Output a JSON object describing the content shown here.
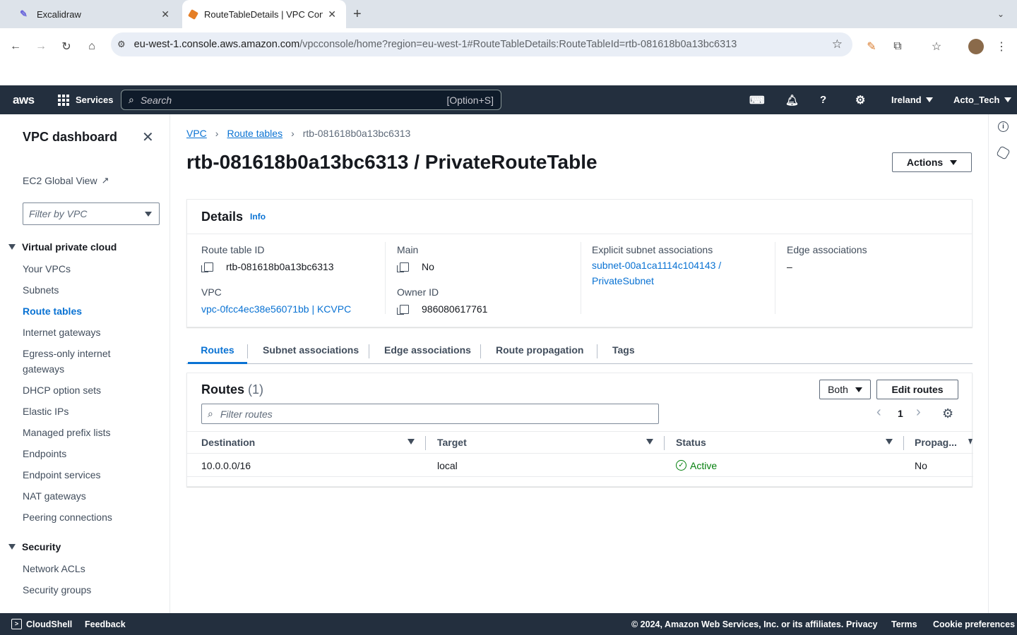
{
  "browser": {
    "tabs": [
      {
        "title": "Excalidraw"
      },
      {
        "title": "RouteTableDetails | VPC Cons"
      }
    ],
    "url_host": "eu-west-1.console.aws.amazon.com",
    "url_path": "/vpcconsole/home?region=eu-west-1#RouteTableDetails:RouteTableId=rtb-081618b0a13bc6313"
  },
  "aws_nav": {
    "logo": "aws",
    "services": "Services",
    "search_placeholder": "Search",
    "search_shortcut": "[Option+S]",
    "region": "Ireland",
    "account": "Acto_Tech"
  },
  "sidebar": {
    "title": "VPC dashboard",
    "ec2_global_view": "EC2 Global View",
    "filter_placeholder": "Filter by VPC",
    "section_vpc": "Virtual private cloud",
    "vpc_items": [
      "Your VPCs",
      "Subnets",
      "Route tables",
      "Internet gateways",
      "Egress-only internet gateways",
      "DHCP option sets",
      "Elastic IPs",
      "Managed prefix lists",
      "Endpoints",
      "Endpoint services",
      "NAT gateways",
      "Peering connections"
    ],
    "active_item": "Route tables",
    "section_security": "Security",
    "security_items": [
      "Network ACLs",
      "Security groups"
    ]
  },
  "breadcrumb": {
    "vpc": "VPC",
    "route_tables": "Route tables",
    "current": "rtb-081618b0a13bc6313"
  },
  "page_title": "rtb-081618b0a13bc6313 / PrivateRouteTable",
  "actions_label": "Actions",
  "details": {
    "title": "Details",
    "info": "Info",
    "route_table_id_label": "Route table ID",
    "route_table_id": "rtb-081618b0a13bc6313",
    "vpc_label": "VPC",
    "vpc": "vpc-0fcc4ec38e56071bb | KCVPC",
    "main_label": "Main",
    "main": "No",
    "owner_label": "Owner ID",
    "owner": "986080617761",
    "explicit_label": "Explicit subnet associations",
    "explicit_line1": "subnet-00a1ca1114c104143 /",
    "explicit_line2": "PrivateSubnet",
    "edge_label": "Edge associations",
    "edge": "–"
  },
  "tabs": [
    "Routes",
    "Subnet associations",
    "Edge associations",
    "Route propagation",
    "Tags"
  ],
  "routes": {
    "title": "Routes",
    "count": "(1)",
    "both_label": "Both",
    "edit_label": "Edit routes",
    "filter_placeholder": "Filter routes",
    "page": "1",
    "columns": [
      "Destination",
      "Target",
      "Status",
      "Propag..."
    ],
    "rows": [
      {
        "destination": "10.0.0.0/16",
        "target": "local",
        "status": "Active",
        "propagated": "No"
      }
    ],
    "status_color": "#037f0c"
  },
  "footer": {
    "cloudshell": "CloudShell",
    "feedback": "Feedback",
    "copyright": "© 2024, Amazon Web Services, Inc. or its affiliates.",
    "privacy": "Privacy",
    "terms": "Terms",
    "cookies": "Cookie preferences"
  }
}
